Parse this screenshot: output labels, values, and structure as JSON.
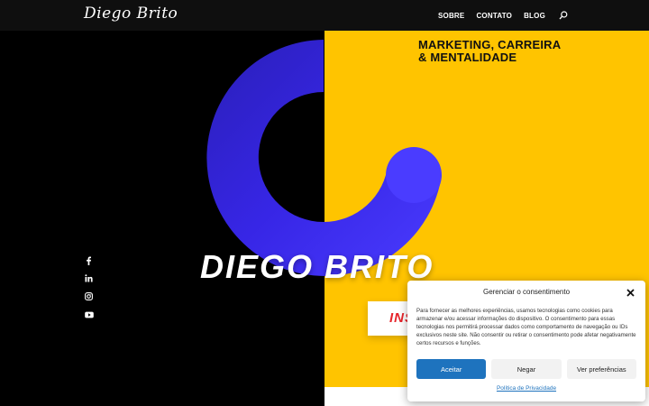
{
  "header": {
    "logo_text": "Diego Brito",
    "nav": [
      {
        "label": "SOBRE"
      },
      {
        "label": "CONTATO"
      },
      {
        "label": "BLOG"
      }
    ],
    "search_icon": "search-icon"
  },
  "hero": {
    "tagline_line1": "MARKETING, CARREIRA",
    "tagline_line2": "& MENTALIDADE",
    "title": "DIEGO BRITO",
    "cta_label": "INS"
  },
  "social": [
    {
      "icon": "facebook-icon",
      "glyph": "f"
    },
    {
      "icon": "linkedin-icon",
      "glyph": "in"
    },
    {
      "icon": "instagram-icon"
    },
    {
      "icon": "youtube-icon"
    }
  ],
  "consent": {
    "title": "Gerenciar o consentimento",
    "text": "Para fornecer as melhores experiências, usamos tecnologias como cookies para armazenar e/ou acessar informações do dispositivo. O consentimento para essas tecnologias nos permitirá processar dados como comportamento de navegação ou IDs exclusivos neste site. Não consentir ou retirar o consentimento pode afetar negativamente certos recursos e funções.",
    "accept_label": "Aceitar",
    "deny_label": "Negar",
    "prefs_label": "Ver preferências",
    "privacy_label": "Política de Privacidade"
  },
  "colors": {
    "yellow": "#ffc400",
    "ring_blue": "#3a2cf0",
    "accept_blue": "#1e73be",
    "cta_red": "#e6242b"
  }
}
